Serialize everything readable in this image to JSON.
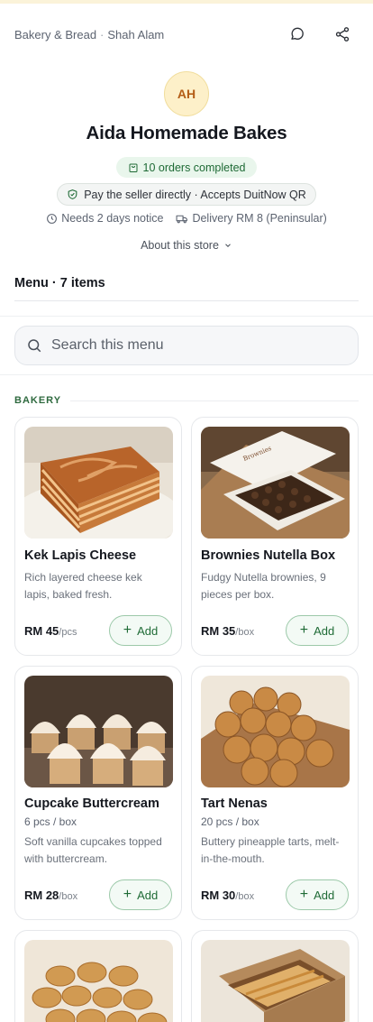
{
  "header": {
    "category": "Bakery & Bread",
    "location": "Shah Alam",
    "separator": "·",
    "chat_icon": "chat-bubble-icon",
    "share_icon": "share-icon"
  },
  "store": {
    "initials": "AH",
    "name": "Aida Homemade Bakes",
    "orders_badge": "10 orders completed",
    "payment_note": "Pay the seller directly · Accepts DuitNow QR",
    "notice": "Needs 2 days notice",
    "delivery": "Delivery RM 8 (Peninsular)",
    "about_label": "About this store"
  },
  "menu": {
    "title": "Menu · 7 items",
    "search_placeholder": "Search this menu",
    "section": "BAKERY"
  },
  "products": [
    {
      "name": "Kek Lapis Cheese",
      "unit": "",
      "desc": "Rich layered cheese kek lapis, baked fresh.",
      "price": "RM 45",
      "per": "/pcs",
      "add": "Add",
      "image": "layer-cake"
    },
    {
      "name": "Brownies Nutella Box",
      "unit": "",
      "desc": "Fudgy Nutella brownies, 9 pieces per box.",
      "price": "RM 35",
      "per": "/box",
      "add": "Add",
      "image": "brownie-box"
    },
    {
      "name": "Cupcake Buttercream",
      "unit": "6 pcs / box",
      "desc": "Soft vanilla cupcakes topped with buttercream.",
      "price": "RM 28",
      "per": "/box",
      "add": "Add",
      "image": "cupcakes"
    },
    {
      "name": "Tart Nenas",
      "unit": "20 pcs / box",
      "desc": "Buttery pineapple tarts, melt-in-the-mouth.",
      "price": "RM 30",
      "per": "/box",
      "add": "Add",
      "image": "pineapple-tarts"
    },
    {
      "name": "",
      "unit": "",
      "desc": "",
      "price": "",
      "per": "",
      "add": "",
      "image": "madeleines"
    },
    {
      "name": "",
      "unit": "",
      "desc": "",
      "price": "",
      "per": "",
      "add": "",
      "image": "cake-box"
    }
  ],
  "colors": {
    "accent_green": "#1f6b36",
    "avatar_bg": "#fdf0c9",
    "avatar_text": "#b45d16"
  }
}
